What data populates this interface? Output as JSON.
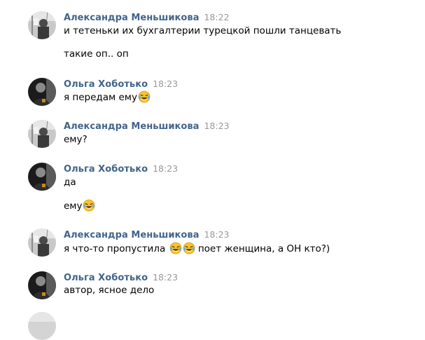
{
  "messages": [
    {
      "author": "Александра Меньшикова",
      "time": "18:22",
      "lines": [
        {
          "text": "и тетеньки их бухгалтерии турецкой пошли танцевать"
        },
        {
          "text": "такие оп.. оп"
        }
      ]
    },
    {
      "author": "Ольга Хоботько",
      "time": "18:23",
      "lines": [
        {
          "text": "я передам ему",
          "emoji": [
            "face-with-tears-of-joy-icon"
          ]
        }
      ]
    },
    {
      "author": "Александра Меньшикова",
      "time": "18:23",
      "lines": [
        {
          "text": "ему?"
        }
      ]
    },
    {
      "author": "Ольга Хоботько",
      "time": "18:23",
      "lines": [
        {
          "text": "да"
        },
        {
          "text": "ему",
          "emoji": [
            "face-with-tears-of-joy-icon"
          ]
        }
      ]
    },
    {
      "author": "Александра Меньшикова",
      "time": "18:23",
      "lines": [
        {
          "text": "я что-то пропустила",
          "emoji": [
            "face-with-tears-of-joy-icon",
            "face-with-tears-of-joy-icon"
          ],
          "text_after": "поет женщина, а ОН кто?)"
        }
      ]
    },
    {
      "author": "Ольга Хоботько",
      "time": "18:23",
      "lines": [
        {
          "text": "автор, ясное дело"
        }
      ]
    }
  ],
  "colors": {
    "author": "#42648b",
    "time": "#999999",
    "text": "#000000",
    "background": "#ffffff"
  }
}
